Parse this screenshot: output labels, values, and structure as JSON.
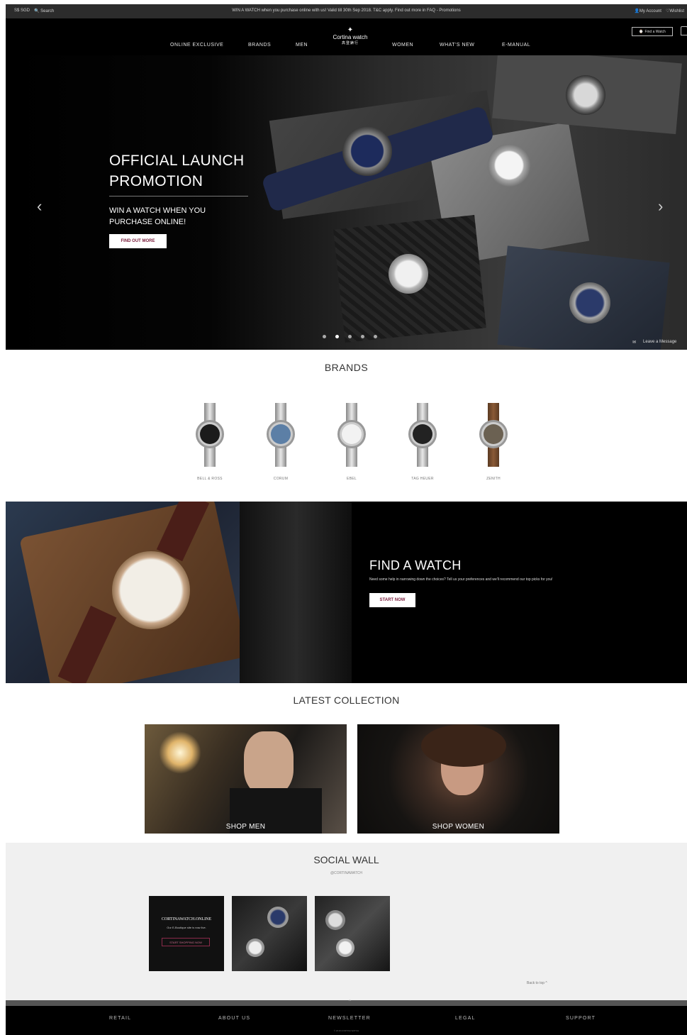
{
  "utility_bar": {
    "locale": "S$ SGD",
    "search_label": "Search",
    "promo_text": "WIN A WATCH when you purchase online with us! Valid till 30th Sep 2018. T&C apply. Find out more in FAQ - Promotions",
    "account_label": "My Account",
    "wishlist_label": "Wishlist"
  },
  "nav": {
    "items": [
      "ONLINE EXCLUSIVE",
      "BRANDS",
      "MEN",
      "WOMEN",
      "WHAT'S NEW",
      "E-MANUAL"
    ],
    "logo_name": "Cortina watch",
    "logo_sub": "高登錶行",
    "find_watch_label": "Find a Watch"
  },
  "hero": {
    "title_line1": "OFFICIAL LAUNCH",
    "title_line2": "PROMOTION",
    "subtitle_line1": "WIN A WATCH WHEN YOU",
    "subtitle_line2": "PURCHASE ONLINE!",
    "button_label": "FIND OUT MORE",
    "slide_count": 5,
    "active_slide": 1,
    "leave_message_label": "Leave a Message"
  },
  "brands": {
    "title": "BRANDS",
    "items": [
      {
        "name": "BELL & ROSS",
        "face_color": "#1b1b1b"
      },
      {
        "name": "CORUM",
        "face_color": "#5c7fa6"
      },
      {
        "name": "EBEL",
        "face_color": "#f2f2f2"
      },
      {
        "name": "TAG HEUER",
        "face_color": "#222222"
      },
      {
        "name": "ZENITH",
        "face_color": "#6b6152"
      }
    ]
  },
  "find_a_watch": {
    "title": "FIND A WATCH",
    "text": "Need some help in narrowing down the choices? Tell us your preferences and we'll recommend our top picks for you!",
    "button_label": "START NOW"
  },
  "latest_collection": {
    "title": "LATEST COLLECTION",
    "shop_men_label": "SHOP MEN",
    "shop_women_label": "SHOP WOMEN"
  },
  "social_wall": {
    "title": "SOCIAL WALL",
    "handle": "@CORTINAWATCH",
    "tile1_brand": "CORTINAWATCH.ONLINE",
    "tile1_tagline": "Our E-Boutique site is now live.",
    "tile1_button": "START SHOPPING NOW",
    "back_to_top": "Back to top ^"
  },
  "footer": {
    "links": [
      "RETAIL",
      "ABOUT US",
      "NEWSLETTER",
      "LEGAL",
      "SUPPORT"
    ],
    "small_text": "© 2018 CORTINA WATCH"
  },
  "colors": {
    "accent": "#7a1b3a",
    "dark": "#000000",
    "light_bg": "#f0f0f0"
  }
}
